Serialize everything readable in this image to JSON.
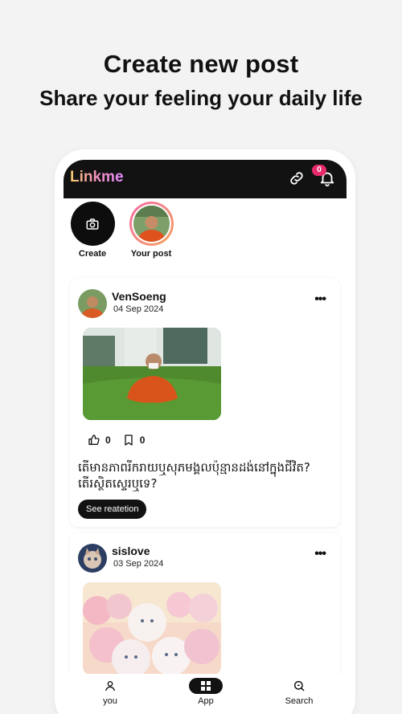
{
  "hero": {
    "title": "Create new post",
    "subtitle": "Share your feeling your daily life"
  },
  "app": {
    "logo": "Linkme",
    "notification_count": "0",
    "colors": {
      "bar": "#121212",
      "badge": "#e62a6b",
      "ring_start": "#f66ba8",
      "ring_end": "#f5a35b"
    }
  },
  "stories": [
    {
      "label": "Create",
      "icon": "camera-icon"
    },
    {
      "label": "Your post",
      "icon": "avatar"
    }
  ],
  "posts": [
    {
      "user": "VenSoeng",
      "date": "04 Sep 2024",
      "likes": "0",
      "saves": "0",
      "caption": "តើមានភាពរីករាយឬសុភមង្គលប៉ុន្មានដង់នៅក្នុងជីវិត? តើរស្ថិតស្ទេរឬទេ?",
      "button": "See reatetion"
    },
    {
      "user": "sislove",
      "date": "03 Sep 2024"
    }
  ],
  "nav": [
    {
      "label": "you",
      "icon": "person-icon"
    },
    {
      "label": "App",
      "icon": "grid-icon"
    },
    {
      "label": "Search",
      "icon": "search-icon"
    }
  ]
}
